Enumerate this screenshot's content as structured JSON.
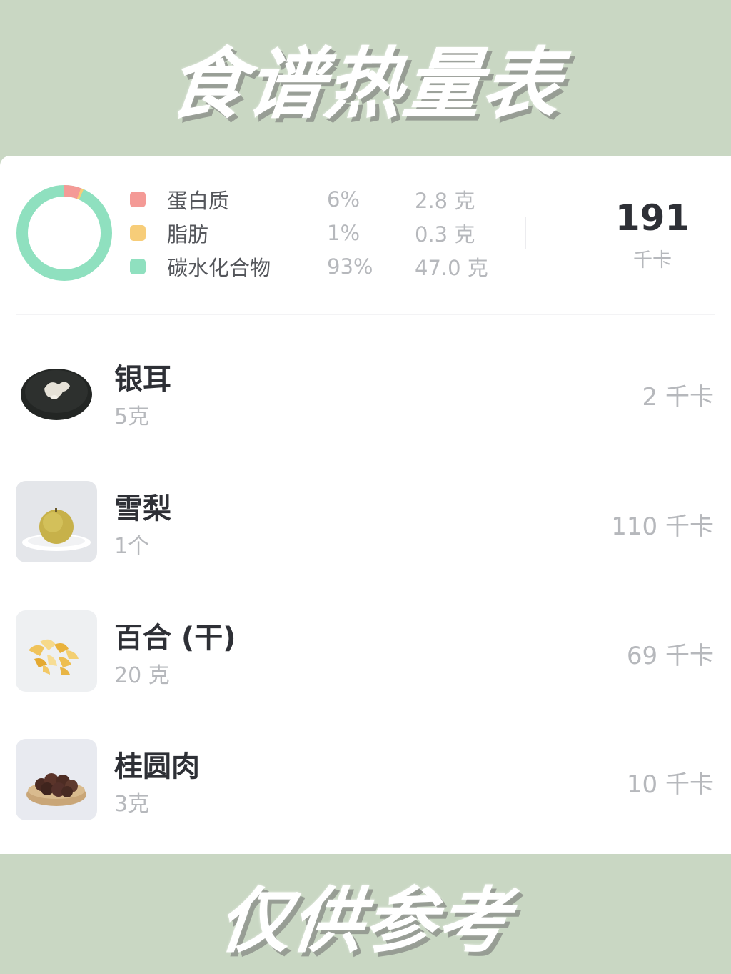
{
  "header": {
    "title": "食谱热量表"
  },
  "footer": {
    "text": "仅供参考"
  },
  "summary": {
    "macros": [
      {
        "name": "蛋白质",
        "percent": "6%",
        "grams": "2.8 克",
        "color": "#f49a96"
      },
      {
        "name": "脂肪",
        "percent": "1%",
        "grams": "0.3 克",
        "color": "#f7cd79"
      },
      {
        "name": "碳水化合物",
        "percent": "93%",
        "grams": "47.0 克",
        "color": "#8fe0bf"
      }
    ],
    "total_kcal": "191",
    "unit": "千卡"
  },
  "ingredients": [
    {
      "name": "银耳",
      "quantity": "5克",
      "kcal": "2 千卡",
      "icon": "white-fungus-image"
    },
    {
      "name": "雪梨",
      "quantity": "1个",
      "kcal": "110 千卡",
      "icon": "snow-pear-image"
    },
    {
      "name": "百合 (干)",
      "quantity": "20 克",
      "kcal": "69 千卡",
      "icon": "dried-lily-image"
    },
    {
      "name": "桂圆肉",
      "quantity": "3克",
      "kcal": "10 千卡",
      "icon": "longan-image"
    }
  ]
}
